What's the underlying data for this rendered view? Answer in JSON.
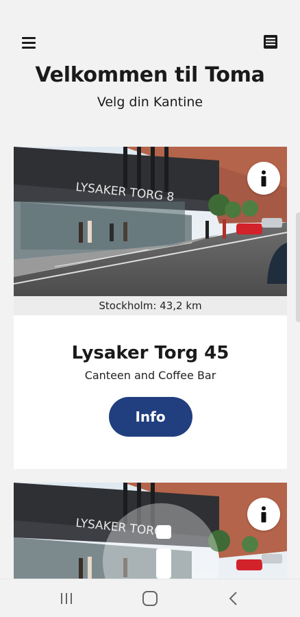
{
  "header": {
    "menu_icon": "hamburger-menu-icon",
    "document_icon": "document-list-icon",
    "title": "Velkommen til Toma",
    "subtitle": "Velg din Kantine"
  },
  "canteens": [
    {
      "image_sign": "LYSAKER TORG 8",
      "distance": "Stockholm: 43,2 km",
      "name": "Lysaker Torg 45",
      "description": "Canteen and Coffee Bar",
      "button_label": "Info",
      "info_icon": "info-icon"
    },
    {
      "image_sign": "LYSAKER TORG",
      "info_icon": "info-icon"
    }
  ],
  "navigation": {
    "recents_icon": "recent-apps-icon",
    "home_icon": "home-icon",
    "back_icon": "back-icon"
  },
  "colors": {
    "background": "#f2f2f2",
    "card": "#ffffff",
    "button": "#213f7f",
    "distance_bar": "#ececec"
  }
}
